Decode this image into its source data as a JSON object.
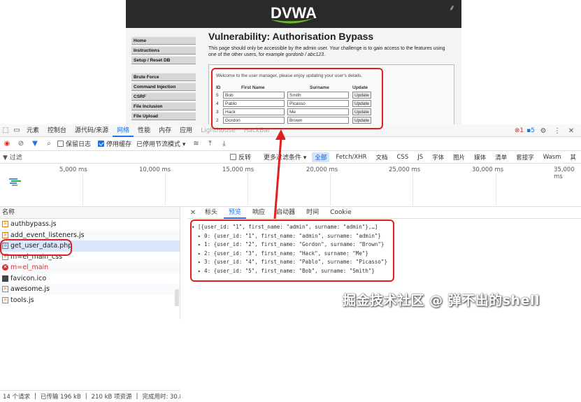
{
  "dvwa": {
    "logo_text": "DVWA",
    "menu": [
      "Home",
      "Instructions",
      "Setup / Reset DB",
      "Brute Force",
      "Command Injection",
      "CSRF",
      "File Inclusion",
      "File Upload"
    ],
    "title": "Vulnerability: Authorisation Bypass",
    "description": "This page should only be accessible by the admin user. Your challenge is to gain access to the features using one of the other users, for example",
    "example": "gordonb / abc123",
    "welcome": "Welcome to the user manager, please enjoy updating your user's details.",
    "table_headers": [
      "ID",
      "First Name",
      "Surname",
      "Update"
    ],
    "rows": [
      {
        "id": "5",
        "first": "Bob",
        "surname": "Smith",
        "btn": "Update"
      },
      {
        "id": "4",
        "first": "Pablo",
        "surname": "Picasso",
        "btn": "Update"
      },
      {
        "id": "3",
        "first": "Hack",
        "surname": "Me",
        "btn": "Update"
      },
      {
        "id": "2",
        "first": "Gordon",
        "surname": "Brown",
        "btn": "Update"
      }
    ]
  },
  "devtools": {
    "tabs": [
      "元素",
      "控制台",
      "源代码/来源",
      "网络",
      "性能",
      "内存",
      "应用",
      "Lighthouse",
      "HackBar"
    ],
    "active_tab": "网络",
    "error_count": "1",
    "message_count": "5",
    "network_toolbar": {
      "preserve_log": "保留日志",
      "disable_cache": "停用缓存",
      "throttle": "已停用节流模式"
    },
    "filter": {
      "placeholder": "过滤",
      "invert": "反转",
      "more_filters": "更多过滤条件",
      "types": [
        "全部",
        "Fetch/XHR",
        "文档",
        "CSS",
        "JS",
        "字体",
        "图片",
        "媒体",
        "清单",
        "套接字",
        "Wasm",
        "其"
      ]
    },
    "timeline_ticks": [
      "5,000 ms",
      "10,000 ms",
      "15,000 ms",
      "20,000 ms",
      "25,000 ms",
      "30,000 ms",
      "35,000 ms"
    ],
    "list_header": "名称",
    "requests": [
      {
        "name": "authbypass.js",
        "icon": "js-file-icon"
      },
      {
        "name": "add_event_listeners.js",
        "icon": "js-file-icon"
      },
      {
        "name": "get_user_data.php",
        "icon": "document-icon"
      },
      {
        "name": "m=el_main_css",
        "icon": "js-file-icon"
      },
      {
        "name": "m=el_main",
        "icon": "error-icon"
      },
      {
        "name": "favicon.ico",
        "icon": "image-icon"
      },
      {
        "name": "awesome.js",
        "icon": "js-file-icon"
      },
      {
        "name": "tools.js",
        "icon": "js-file-icon"
      }
    ],
    "status": {
      "requests": "14 个请求",
      "transferred": "已传输 196 kB",
      "resources": "210 kB 项资源",
      "finish": "完成用时: 30.8"
    },
    "detail_tabs": [
      "标头",
      "预览",
      "响应",
      "启动器",
      "时间",
      "Cookie"
    ],
    "active_detail_tab": "预览",
    "preview_lines": [
      "▾ [{user_id: \"1\", first_name: \"admin\", surname: \"admin\"},…]",
      "  ▸ 0: {user_id: \"1\", first_name: \"admin\", surname: \"admin\"}",
      "  ▸ 1: {user_id: \"2\", first_name: \"Gordon\", surname: \"Brown\"}",
      "  ▸ 2: {user_id: \"3\", first_name: \"Hack\", surname: \"Me\"}",
      "  ▸ 3: {user_id: \"4\", first_name: \"Pablo\", surname: \"Picasso\"}",
      "  ▸ 4: {user_id: \"5\", first_name: \"Bob\", surname: \"Smith\"}"
    ]
  },
  "watermark": "掘金技术社区 @ 弹不出的shell",
  "colors": {
    "accent": "#1a73e8",
    "annotation": "#e02020",
    "error": "#d93025"
  }
}
